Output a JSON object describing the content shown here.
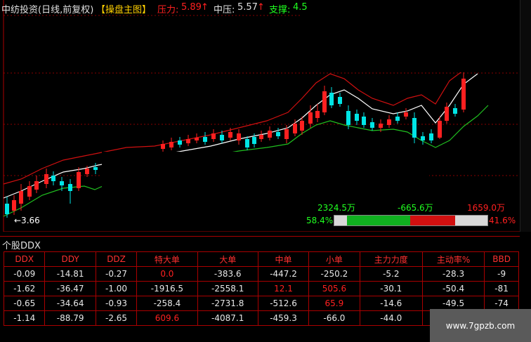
{
  "header": {
    "stock": "中纺投资(日线,前复权)",
    "indicator": "【操盘主图】",
    "pressure_label": "压力:",
    "pressure_value": "5.89",
    "mid_label": "中压:",
    "mid_value": "5.57",
    "support_label": "支撑:",
    "support_value": "4.5"
  },
  "price_low_label": "←3.66",
  "flow": {
    "left_value": "2324.5万",
    "mid_value": "-665.6万",
    "right_value": "1659.0万",
    "left_percent": "58.4%",
    "right_percent": "41.6%",
    "green_share": 0.584,
    "red_share": 0.416
  },
  "sub_panel": {
    "title": "个股DDX"
  },
  "table": {
    "headers": [
      "DDX",
      "DDY",
      "DDZ",
      "特大单",
      "大单",
      "中单",
      "小单",
      "主力力度",
      "主动率%",
      "BBD"
    ],
    "rows": [
      [
        {
          "v": "-0.09",
          "c": "white"
        },
        {
          "v": "-14.81",
          "c": "white"
        },
        {
          "v": "-0.27",
          "c": "white"
        },
        {
          "v": "0.0",
          "c": "red"
        },
        {
          "v": "-383.6",
          "c": "white"
        },
        {
          "v": "-447.2",
          "c": "white"
        },
        {
          "v": "-250.2",
          "c": "white"
        },
        {
          "v": "-5.2",
          "c": "white"
        },
        {
          "v": "-28.3",
          "c": "white"
        },
        {
          "v": "-9",
          "c": "white"
        }
      ],
      [
        {
          "v": "-1.62",
          "c": "white"
        },
        {
          "v": "-36.47",
          "c": "white"
        },
        {
          "v": "-1.00",
          "c": "white"
        },
        {
          "v": "-1916.5",
          "c": "white"
        },
        {
          "v": "-2558.1",
          "c": "white"
        },
        {
          "v": "12.1",
          "c": "red"
        },
        {
          "v": "505.6",
          "c": "red"
        },
        {
          "v": "-30.1",
          "c": "white"
        },
        {
          "v": "-50.4",
          "c": "white"
        },
        {
          "v": "-81",
          "c": "white"
        }
      ],
      [
        {
          "v": "-0.65",
          "c": "white"
        },
        {
          "v": "-34.64",
          "c": "white"
        },
        {
          "v": "-0.93",
          "c": "white"
        },
        {
          "v": "-258.4",
          "c": "white"
        },
        {
          "v": "-2731.8",
          "c": "white"
        },
        {
          "v": "-512.6",
          "c": "white"
        },
        {
          "v": "65.9",
          "c": "red"
        },
        {
          "v": "-14.6",
          "c": "white"
        },
        {
          "v": "-49.5",
          "c": "white"
        },
        {
          "v": "-74",
          "c": "white"
        }
      ],
      [
        {
          "v": "-1.14",
          "c": "white"
        },
        {
          "v": "-88.79",
          "c": "white"
        },
        {
          "v": "-2.65",
          "c": "white"
        },
        {
          "v": "609.6",
          "c": "red"
        },
        {
          "v": "-4087.1",
          "c": "white"
        },
        {
          "v": "-459.3",
          "c": "white"
        },
        {
          "v": "-66.0",
          "c": "white"
        },
        {
          "v": "-44.0",
          "c": "white"
        },
        {
          "v": "",
          "c": "white"
        },
        {
          "v": "",
          "c": "white"
        }
      ]
    ]
  },
  "watermark": "www.7gpzb.com",
  "colors": {
    "up": "#ff2020",
    "down": "#00e5e5",
    "upper_band": "#d01010",
    "lower_band": "#20c020",
    "mid_line": "#ffffff",
    "grid": "#aa0000"
  }
}
